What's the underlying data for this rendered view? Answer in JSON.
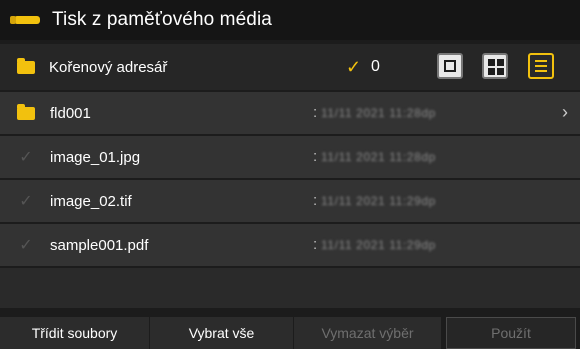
{
  "header": {
    "title": "Tisk z paměťového média",
    "accent": "#f2c10e"
  },
  "directory": {
    "label": "Kořenový adresář",
    "selected_count": "0"
  },
  "view_modes": [
    "single",
    "thumbnails",
    "list"
  ],
  "files": [
    {
      "name": "fld001",
      "type": "folder",
      "separator": ":",
      "date": "11/11 2021 11:28dp"
    },
    {
      "name": "image_01.jpg",
      "type": "file",
      "separator": ":",
      "date": "11/11 2021 11:28dp"
    },
    {
      "name": "image_02.tif",
      "type": "file",
      "separator": ":",
      "date": "11/11 2021 11:29dp"
    },
    {
      "name": "sample001.pdf",
      "type": "file",
      "separator": ":",
      "date": "11/11 2021 11:29dp"
    }
  ],
  "footer": {
    "sort_label": "Třídit soubory",
    "select_all_label": "Vybrat vše",
    "clear_selection_label": "Vymazat výběr",
    "apply_label": "Použít"
  }
}
